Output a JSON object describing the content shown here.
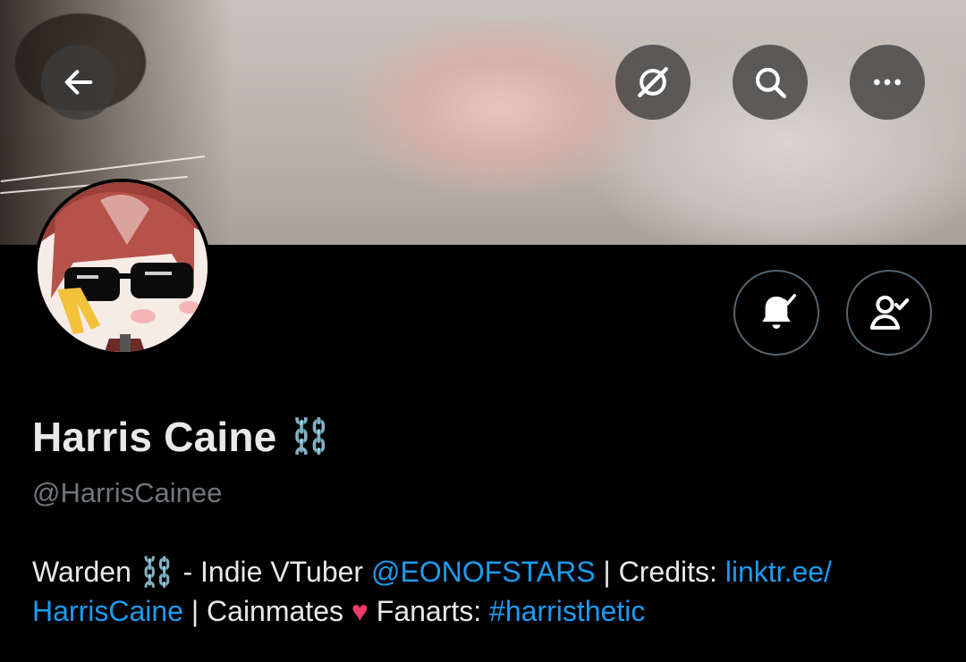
{
  "header": {
    "back_icon": "arrow-left-icon",
    "grok_icon": "grok-icon",
    "search_icon": "search-icon",
    "more_icon": "more-horizontal-icon"
  },
  "profile": {
    "display_name": "Harris Caine",
    "name_emoji": "⛓️",
    "handle": "@HarrisCainee"
  },
  "actions": {
    "notifications_icon": "bell-check-icon",
    "following_icon": "user-check-icon"
  },
  "bio": {
    "part1": "Warden ",
    "emoji": "⛓️",
    "part2": " - Indie VTuber ",
    "mention": "@EONOFSTARS",
    "part3": " | Credits: ",
    "link_line1": "linktr.ee/",
    "link_line2": "HarrisCaine",
    "part4": " | Cainmates ",
    "heart": "♥",
    "part5": " Fanarts: ",
    "hashtag": "#harristhetic"
  },
  "colors": {
    "accent": "#1d9bf0",
    "background": "#000000",
    "muted": "#71767b"
  }
}
